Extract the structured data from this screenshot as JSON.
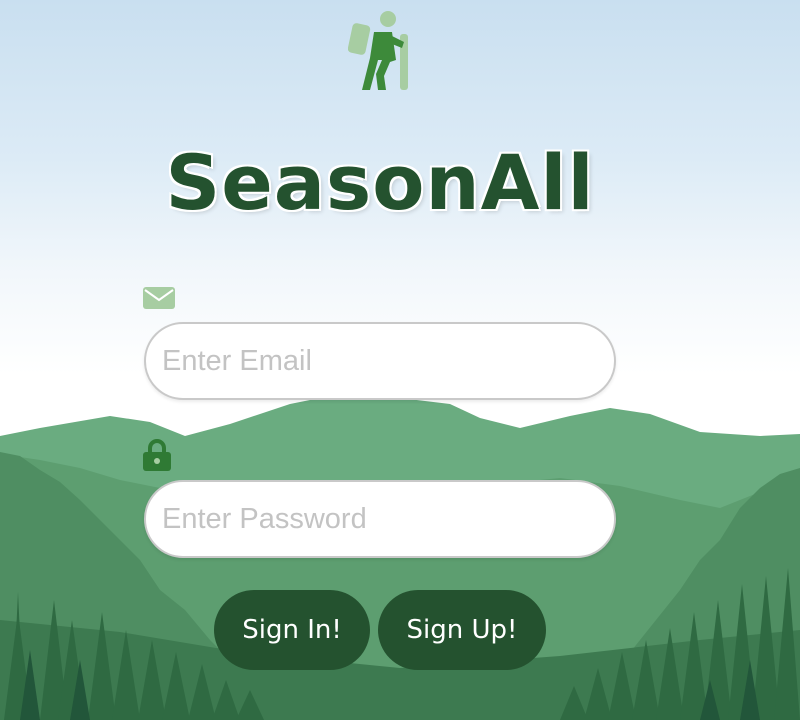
{
  "app": {
    "name": "SeasonAll",
    "logo_icon": "hiker-icon",
    "brand_color": "#24522f",
    "accent_light": "#a7cda2"
  },
  "login": {
    "email": {
      "icon": "mail-icon",
      "placeholder": "Enter Email",
      "value": ""
    },
    "password": {
      "icon": "lock-icon",
      "placeholder": "Enter Password",
      "value": ""
    },
    "buttons": {
      "sign_in": "Sign In!",
      "sign_up": "Sign Up!"
    }
  },
  "background": {
    "sky_top": "#c9dff0",
    "hill_far": "#6aac80",
    "hill_mid": "#4f8e62",
    "forest_dark": "#2f6a42"
  }
}
